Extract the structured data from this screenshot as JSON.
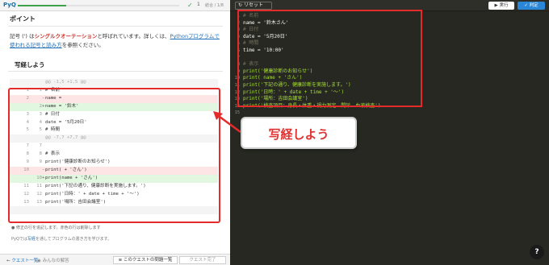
{
  "topbar": {
    "logo": "PyQ",
    "progress": 0.3,
    "check_icon": "check-icon",
    "step_count": "1",
    "step_sub": "結合 / 1/8"
  },
  "point": {
    "title": "ポイント",
    "body_pre": "記号 (') は",
    "body_hl": "シングルクオーテーション",
    "body_mid": "と呼ばれています。詳しくは、",
    "body_link": "Pythonプログラムで使われる記号と読み方",
    "body_post": "を参照ください。"
  },
  "copy_heading": "写経しよう",
  "diff_rows": [
    {
      "ln1": "",
      "ln2": "",
      "mk": "",
      "text": "@@ -1,5 +1,5 @@",
      "type": "hunk"
    },
    {
      "ln1": "1",
      "ln2": "1",
      "mk": "",
      "text": "# 名前",
      "type": "ctx"
    },
    {
      "ln1": "2",
      "ln2": "",
      "mk": "-",
      "text": "name =",
      "type": "del"
    },
    {
      "ln1": "",
      "ln2": "2",
      "mk": "+",
      "text": "name = '鈴木'",
      "type": "add"
    },
    {
      "ln1": "3",
      "ln2": "3",
      "mk": "",
      "text": "# 日付",
      "type": "ctx"
    },
    {
      "ln1": "4",
      "ln2": "4",
      "mk": "",
      "text": "date = '5月20日'",
      "type": "ctx"
    },
    {
      "ln1": "5",
      "ln2": "5",
      "mk": "",
      "text": "# 時間",
      "type": "ctx"
    },
    {
      "ln1": "",
      "ln2": "",
      "mk": "",
      "text": "@@ -7,7 +7,7 @@",
      "type": "hunk"
    },
    {
      "ln1": "7",
      "ln2": "7",
      "mk": "",
      "text": "",
      "type": "ctx"
    },
    {
      "ln1": "8",
      "ln2": "8",
      "mk": "",
      "text": "# 表示",
      "type": "ctx"
    },
    {
      "ln1": "9",
      "ln2": "9",
      "mk": "",
      "text": "print('健康診断のお知らせ')",
      "type": "ctx"
    },
    {
      "ln1": "10",
      "ln2": "",
      "mk": "-",
      "text": "print( + 'さん')",
      "type": "del"
    },
    {
      "ln1": "",
      "ln2": "10",
      "mk": "+",
      "text": "print(name + 'さん')",
      "type": "add"
    },
    {
      "ln1": "11",
      "ln2": "11",
      "mk": "",
      "text": "print('下記の通り、健康診断を実施します。')",
      "type": "ctx"
    },
    {
      "ln1": "12",
      "ln2": "12",
      "mk": "",
      "text": "print('日時：' + date + time + '〜')",
      "type": "ctx"
    },
    {
      "ln1": "13",
      "ln2": "13",
      "mk": "",
      "text": "print('場所：吉田会議室')",
      "type": "ctx"
    },
    {
      "ln1": "",
      "ln2": "",
      "mk": "",
      "text": "",
      "type": "hunk"
    }
  ],
  "notes": {
    "note1": "● 修正の行を追記します。赤色の行は削除します",
    "note2_pre": "PyQでは",
    "note2_link": "写経",
    "note2_post": "を通してプログラムの書き方を学びます。"
  },
  "bottombar": {
    "quest_list": "クエスト一覧",
    "ranking": "みんなの解答",
    "quest_problems": "このクエストの問題一覧",
    "quest_complete": "クエスト完了"
  },
  "editor": {
    "reset_label": "リセット",
    "run_label": "▶ 実行",
    "judge_label": "✓ 判定",
    "lines": [
      {
        "n": "1",
        "text": "# 名前",
        "kind": "comment"
      },
      {
        "n": "2",
        "text": "name = '鈴木さん'",
        "kind": "plain"
      },
      {
        "n": "3",
        "text": "# 日付",
        "kind": "comment"
      },
      {
        "n": "4",
        "text": "date = '5月20日'",
        "kind": "plain"
      },
      {
        "n": "5",
        "text": "# 時間",
        "kind": "comment"
      },
      {
        "n": "6",
        "text": "time = '10:00'",
        "kind": "plain"
      },
      {
        "n": "7",
        "text": "",
        "kind": "plain"
      },
      {
        "n": "8",
        "text": "# 表示",
        "kind": "comment"
      },
      {
        "n": "9",
        "text": "print('健康診断のお知らせ')",
        "kind": "print"
      },
      {
        "n": "10",
        "text": "print( name + 'さん')",
        "kind": "print"
      },
      {
        "n": "11",
        "text": "print('下記の通り、健康診断を実施します。')",
        "kind": "print"
      },
      {
        "n": "12",
        "text": "print('日時：' + date + time + '〜')",
        "kind": "print"
      },
      {
        "n": "13",
        "text": "print('場所：吉田会議室')",
        "kind": "print"
      },
      {
        "n": "14",
        "text": "print('検査項目：身長・体重・視力測定、問診、血液検査')",
        "kind": "print"
      },
      {
        "n": "15",
        "text": "",
        "kind": "plain"
      }
    ]
  },
  "callout": {
    "text": "写経しよう"
  },
  "help_label": "?",
  "colors": {
    "accent_red": "#e52a2a",
    "editor_bg": "#272822",
    "link_blue": "#1e6fb8",
    "judge_blue": "#2a86d6"
  }
}
